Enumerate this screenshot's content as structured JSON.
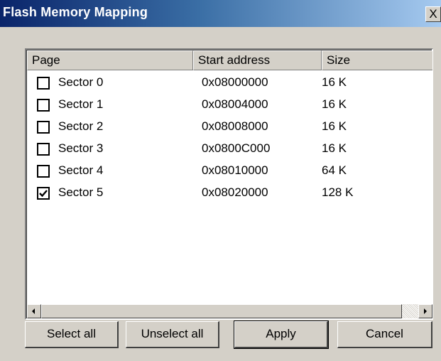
{
  "window": {
    "title": "Flash Memory Mapping",
    "close_label": "X"
  },
  "columns": {
    "page": "Page",
    "start": "Start address",
    "size": "Size"
  },
  "rows": [
    {
      "page": "Sector 0",
      "start": "0x08000000",
      "size": "16 K",
      "checked": false
    },
    {
      "page": "Sector 1",
      "start": "0x08004000",
      "size": "16 K",
      "checked": false
    },
    {
      "page": "Sector 2",
      "start": "0x08008000",
      "size": "16 K",
      "checked": false
    },
    {
      "page": "Sector 3",
      "start": "0x0800C000",
      "size": "16 K",
      "checked": false
    },
    {
      "page": "Sector 4",
      "start": "0x08010000",
      "size": "64 K",
      "checked": false
    },
    {
      "page": "Sector 5",
      "start": "0x08020000",
      "size": "128 K",
      "checked": true
    }
  ],
  "buttons": {
    "select_all": "Select all",
    "unselect_all": "Unselect all",
    "apply": "Apply",
    "cancel": "Cancel"
  }
}
